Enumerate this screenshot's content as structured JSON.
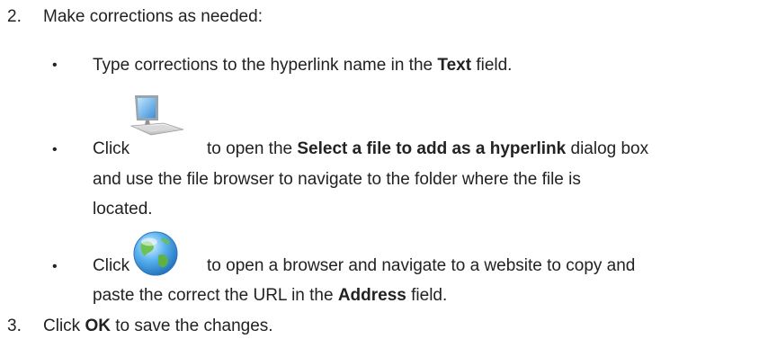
{
  "steps": {
    "step2": {
      "number": "2.",
      "text": "Make corrections as needed:",
      "bullets": {
        "b1": {
          "marker": "•",
          "pre": "Type corrections to the hyperlink name in the ",
          "bold": "Text",
          "post": " field."
        },
        "b2": {
          "marker": "•",
          "click": "Click",
          "icon": "computer-icon",
          "pre": "to open the ",
          "bold": "Select a file to add as a hyperlink",
          "post": " dialog box",
          "line2": "and use the file browser to navigate to the folder where the file is",
          "line3": "located."
        },
        "b3": {
          "marker": "•",
          "click": "Click",
          "icon": "globe-icon",
          "line1": "to open a browser and navigate to a website to copy and",
          "pre2": "paste the correct the URL in the ",
          "bold": "Address",
          "post2": " field."
        }
      }
    },
    "step3": {
      "number": "3.",
      "pre": "Click ",
      "bold": "OK",
      "post": " to save the changes."
    }
  }
}
